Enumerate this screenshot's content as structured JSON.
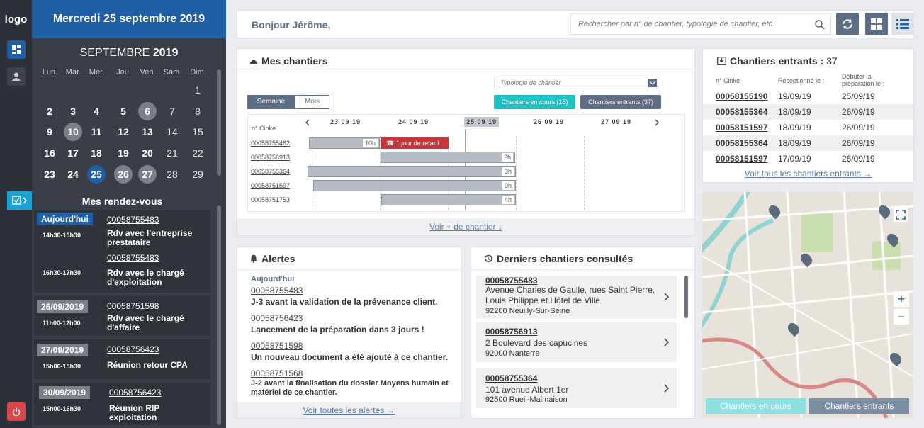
{
  "sidebar": {
    "logo": "logo"
  },
  "calendar": {
    "header_date": "Mercredi 25 septembre 2019",
    "month": "SEPTEMBRE",
    "year": "2019",
    "weekdays": [
      "Lun.",
      "Mar.",
      "Mer.",
      "Jeu.",
      "Ven.",
      "Sam.",
      "Dim."
    ],
    "weeks": [
      [
        "",
        "",
        "",
        "",
        "",
        "",
        "1"
      ],
      [
        "2",
        "3",
        "4",
        "5",
        "6",
        "7",
        "8"
      ],
      [
        "9",
        "10",
        "11",
        "12",
        "13",
        "14",
        "15"
      ],
      [
        "16",
        "17",
        "18",
        "19",
        "20",
        "21",
        "22"
      ],
      [
        "23",
        "24",
        "25",
        "26",
        "27",
        "28",
        "29"
      ]
    ]
  },
  "rdv": {
    "title": "Mes rendez-vous",
    "cards": [
      {
        "date": "Aujourd'hui",
        "items": [
          {
            "ref": "00058755483",
            "time": "14h30-15h30",
            "desc": "Rdv avec l'entreprise prestataire"
          },
          {
            "ref": "00058755483",
            "time": "16h30-17h30",
            "desc": "Rdv avec le chargé d'exploitation"
          }
        ]
      },
      {
        "date": "26/09/2019",
        "items": [
          {
            "ref": "00058751598",
            "time": "11h00-12h00",
            "desc": "Rdv avec le chargé d'affaire"
          }
        ]
      },
      {
        "date": "27/09/2019",
        "items": [
          {
            "ref": "00058756423",
            "time": "15h00-15h30",
            "desc": "Réunion retour CPA"
          }
        ]
      },
      {
        "date": "30/09/2019",
        "items": [
          {
            "ref": "00058756423",
            "time": "15h00-16h30",
            "desc": "Réunion RIP exploitation"
          }
        ]
      }
    ]
  },
  "topbar": {
    "greeting": "Bonjour Jérôme,",
    "search_placeholder": "Rechercher par n° de chantier, typologie de chantier, etc"
  },
  "chantiers": {
    "title": "Mes chantiers",
    "typologie_placeholder": "Typologie de chantier",
    "tabs": [
      "Semaine",
      "Mois"
    ],
    "btn_en_cours": "Chantiers en cours (18)",
    "btn_entrants": "Chantiers entrants (37)",
    "col_label": "n° Cinke",
    "dates": [
      "23 09 19",
      "24 09 19",
      "25 09 19",
      "26 09 19",
      "27 09 19"
    ],
    "rows": [
      {
        "ref": "00058755482",
        "hours": "10h",
        "alert": "1 jour de retard"
      },
      {
        "ref": "00058756913",
        "hours": "2h"
      },
      {
        "ref": "00058755364",
        "hours": "3h"
      },
      {
        "ref": "00058751597",
        "hours": "9h"
      },
      {
        "ref": "00058751753",
        "hours": "4h"
      }
    ],
    "footer": "Voir + de chantier"
  },
  "entrants": {
    "title": "Chantiers entrants :",
    "count": "37",
    "headers": [
      "n° Cinke",
      "Réceptionné le :",
      "Débuter la préparation le :"
    ],
    "rows": [
      [
        "00058155190",
        "19/09/19",
        "25/09/19"
      ],
      [
        "00058155364",
        "18/09/19",
        "26/09/19"
      ],
      [
        "00058151597",
        "18/09/19",
        "26/09/19"
      ],
      [
        "00058155364",
        "18/09/19",
        "26/09/19"
      ],
      [
        "00058151597",
        "17/09/19",
        "26/09/19"
      ]
    ],
    "footer": "Voir tous les chantiers entrants"
  },
  "alertes": {
    "title": "Alertes",
    "today": "Aujourd'hui",
    "items": [
      {
        "ref": "00058755483",
        "text": "J-3 avant la validation de la prévenance client."
      },
      {
        "ref": "00058756423",
        "text": "Lancement de la préparation dans 3 jours !"
      },
      {
        "ref": "00058751598",
        "text": "Un nouveau document a été ajouté à ce chantier."
      },
      {
        "ref": "00058751568",
        "text": "J-2 avant la finalisation du dossier Moyens humain et matériel de ce chantier."
      }
    ],
    "footer": "Voir toutes les alertes"
  },
  "consultes": {
    "title": "Derniers chantiers consultés",
    "items": [
      {
        "ref": "00058755483",
        "addr": "Avenue Charles de Gaulle, rues Saint Pierre, Louis Philippe et Hôtel de Ville",
        "city": "92200 Neuilly-Sur-Seine"
      },
      {
        "ref": "00058756913",
        "addr": "2 Boulevard des capucines",
        "city": "92000 Nanterre"
      },
      {
        "ref": "00058755364",
        "addr": "101 avenue Albert 1er",
        "city": "92500 Rueil-Malmaison"
      }
    ]
  },
  "map": {
    "btn_en_cours": "Chantiers en cours",
    "btn_entrants": "Chantiers entrants",
    "zoom_in": "+",
    "zoom_out": "−"
  },
  "colors": {
    "primary": "#1f5fa6",
    "teal": "#1ec3c3",
    "alert_red": "#c8373b",
    "sidebar": "#2c3038"
  }
}
